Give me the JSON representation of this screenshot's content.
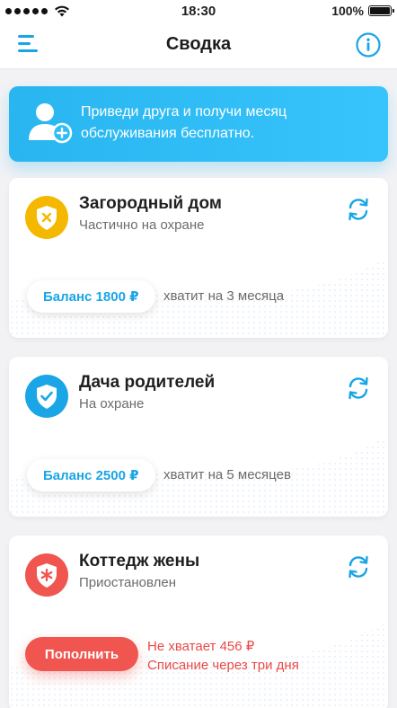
{
  "status_bar": {
    "time": "18:30",
    "battery": "100%",
    "signal_bars": 5
  },
  "header": {
    "title": "Сводка",
    "menu_icon": "menu-icon",
    "info_icon": "info-icon"
  },
  "promo": {
    "text": "Приведи друга и получи месяц обслуживания бесплатно.",
    "icon": "add-user-icon"
  },
  "objects": [
    {
      "title": "Загородный дом",
      "status": "Частично на охране",
      "icon": "shield-warning-icon",
      "icon_color": "#f5b800",
      "balance_label": "Баланс 1800 ₽",
      "balance_note": "хватит на 3 месяца"
    },
    {
      "title": "Дача родителей",
      "status": "На охране",
      "icon": "shield-check-icon",
      "icon_color": "#1aa5e6",
      "balance_label": "Баланс 2500 ₽",
      "balance_note": "хватит на 5 месяцев"
    },
    {
      "title": "Коттедж жены",
      "status": "Приостановлен",
      "icon": "shield-alert-icon",
      "icon_color": "#f0554f",
      "button_label": "Пополнить",
      "warning_line1": "Не хватает 456 ₽",
      "warning_line2": "Списание через три дня"
    }
  ],
  "colors": {
    "accent": "#1aa5e6",
    "promo": "#2fbdf6",
    "danger": "#f0554f",
    "background": "#f2f2f4"
  }
}
